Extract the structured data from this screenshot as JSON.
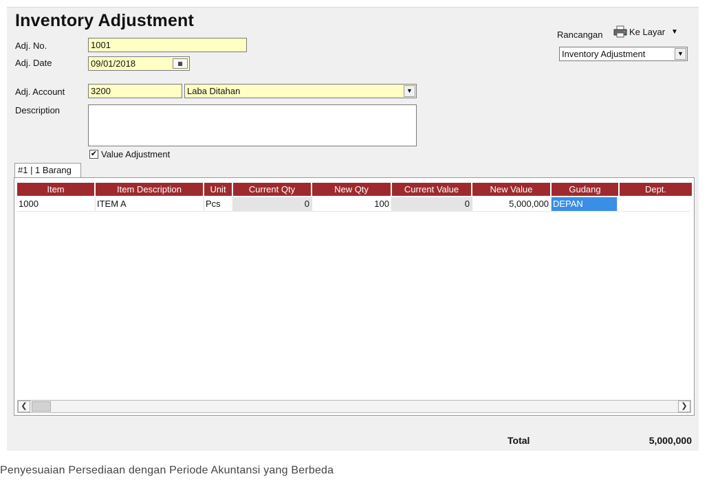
{
  "header": {
    "title": "Inventory Adjustment",
    "design_label": "Rancangan",
    "print_target": "Ke Layar",
    "template_select": "Inventory Adjustment"
  },
  "form": {
    "adj_no_label": "Adj. No.",
    "adj_no": "1001",
    "adj_date_label": "Adj. Date",
    "adj_date": "09/01/2018",
    "adj_account_label": "Adj. Account",
    "adj_account_code": "3200",
    "adj_account_name": "Laba Ditahan",
    "description_label": "Description",
    "description": "",
    "value_adjustment_label": "Value Adjustment",
    "value_adjustment_checked": true
  },
  "tab": {
    "label": "#1 | 1 Barang"
  },
  "table": {
    "columns": [
      "Item",
      "Item Description",
      "Unit",
      "Current Qty",
      "New Qty",
      "Current Value",
      "New Value",
      "Gudang",
      "Dept."
    ],
    "rows": [
      {
        "item": "1000",
        "description": "ITEM A",
        "unit": "Pcs",
        "current_qty": "0",
        "new_qty": "100",
        "current_value": "0",
        "new_value": "5,000,000",
        "gudang": "DEPAN",
        "dept": ""
      }
    ]
  },
  "footer": {
    "total_label": "Total",
    "total_value": "5,000,000"
  },
  "caption": "Penyesuaian Persediaan dengan Periode Akuntansi yang Berbeda",
  "colors": {
    "header_bg": "#9e2a2f",
    "field_bg": "#ffffc4",
    "selection": "#3a8ee6"
  }
}
